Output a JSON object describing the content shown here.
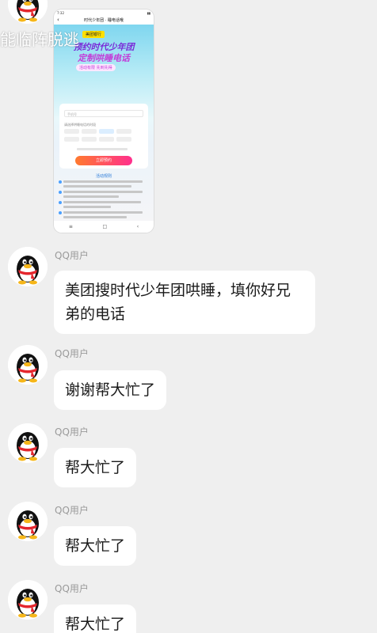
{
  "overlay": {
    "title": "能临阵脱逃"
  },
  "screenshot": {
    "status_time": "7:32",
    "nav_title": "时代少年团 · 睡电话哦",
    "brand": "美团银行",
    "headline_1": "预约时代少年团",
    "headline_2": "定制哄睡电话",
    "tag": "活动有限 先到先得",
    "phone_placeholder": "手机号",
    "select_label": "请选择哄睡电话的时段",
    "submit_label": "立即预约",
    "rules_title": "活动规则",
    "nav_icons": [
      "menu-icon",
      "home-icon",
      "back-icon"
    ]
  },
  "messages": [
    {
      "sender": "QQ用户",
      "text": "美团搜时代少年团哄睡，填你好兄弟的电话"
    },
    {
      "sender": "QQ用户",
      "text": "谢谢帮大忙了"
    },
    {
      "sender": "QQ用户",
      "text": "帮大忙了"
    },
    {
      "sender": "QQ用户",
      "text": "帮大忙了"
    },
    {
      "sender": "QQ用户",
      "text": "帮大忙了"
    }
  ]
}
